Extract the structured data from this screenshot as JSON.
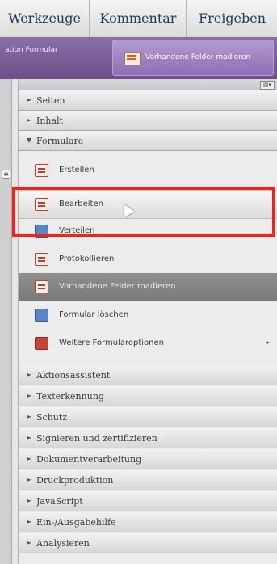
{
  "tabs": [
    "Werkzeuge",
    "Kommentar",
    "Freigeben"
  ],
  "toolbar": {
    "label": "ation Formular",
    "button_label": "Vorhandene Felder madieren"
  },
  "strip": {
    "collapse_glyph": "≡"
  },
  "panel": {
    "options_glyph": "▤▾"
  },
  "sections_top": [
    {
      "label": "Seiten",
      "arrow": "►"
    },
    {
      "label": "Inhalt",
      "arrow": "►"
    },
    {
      "label": "Formulare",
      "arrow": "▼"
    }
  ],
  "form_items": [
    {
      "label": "Erstellen",
      "icon": "form-create-icon"
    },
    {
      "label": "Bearbeiten",
      "icon": "form-edit-icon"
    },
    {
      "label": "Verteilen",
      "icon": "form-distribute-icon"
    },
    {
      "label": "Protokollieren",
      "icon": "form-track-icon"
    },
    {
      "label": "Vorhandene Felder madieren",
      "icon": "form-fields-icon"
    },
    {
      "label": "Formular löschen",
      "icon": "form-delete-icon"
    },
    {
      "label": "Weitere Formularoptionen",
      "icon": "form-more-icon",
      "more": "▾"
    }
  ],
  "sections_bottom": [
    {
      "label": "Aktionsassistent",
      "arrow": "►"
    },
    {
      "label": "Texterkennung",
      "arrow": "►"
    },
    {
      "label": "Schutz",
      "arrow": "►"
    },
    {
      "label": "Signieren und zertifizieren",
      "arrow": "►"
    },
    {
      "label": "Dokumentverarbeitung",
      "arrow": "►"
    },
    {
      "label": "Druckproduktion",
      "arrow": "►"
    },
    {
      "label": "JavaScript",
      "arrow": "►"
    },
    {
      "label": "Ein-/Ausgabehilfe",
      "arrow": "►"
    },
    {
      "label": "Analysieren",
      "arrow": "►"
    }
  ],
  "colors": {
    "highlight": "#e8251f",
    "toolbar": "#7a5f9a"
  }
}
